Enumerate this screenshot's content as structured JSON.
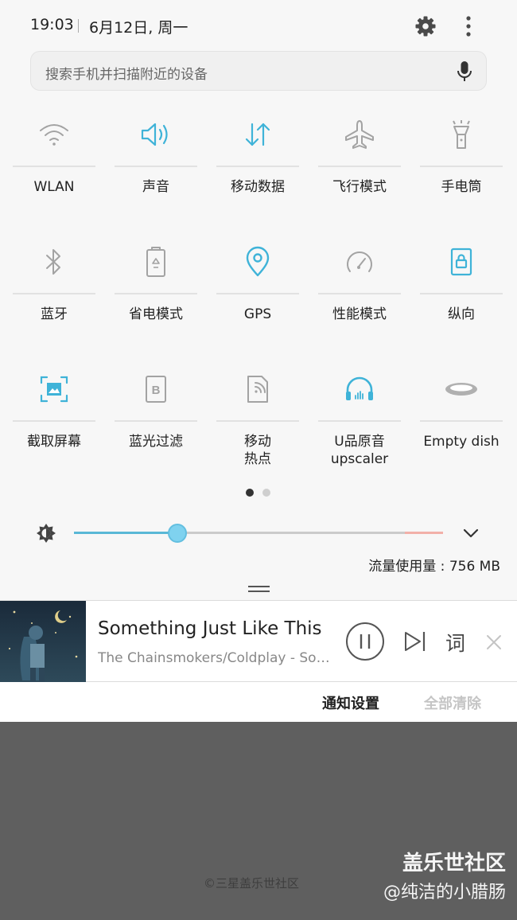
{
  "status_bar": {
    "time": "19:03",
    "date": "6月12日, 周一"
  },
  "search": {
    "placeholder": "搜索手机并扫描附近的设备"
  },
  "tiles": [
    {
      "label": "WLAN",
      "icon": "wifi-icon",
      "active": false
    },
    {
      "label": "声音",
      "icon": "sound-icon",
      "active": true
    },
    {
      "label": "移动数据",
      "icon": "mobile-data-icon",
      "active": true
    },
    {
      "label": "飞行模式",
      "icon": "airplane-icon",
      "active": false
    },
    {
      "label": "手电筒",
      "icon": "flashlight-icon",
      "active": false
    },
    {
      "label": "蓝牙",
      "icon": "bluetooth-icon",
      "active": false
    },
    {
      "label": "省电模式",
      "icon": "battery-saver-icon",
      "active": false
    },
    {
      "label": "GPS",
      "icon": "gps-icon",
      "active": true
    },
    {
      "label": "性能模式",
      "icon": "performance-icon",
      "active": false
    },
    {
      "label": "纵向",
      "icon": "portrait-lock-icon",
      "active": true
    },
    {
      "label": "截取屏幕",
      "icon": "screenshot-icon",
      "active": true
    },
    {
      "label": "蓝光过滤",
      "icon": "blue-light-filter-icon",
      "active": false
    },
    {
      "label": "移动\n热点",
      "icon": "hotspot-icon",
      "active": false
    },
    {
      "label": "U品原音\nupscaler",
      "icon": "headphones-icon",
      "active": true
    },
    {
      "label": "Empty dish",
      "icon": "dish-icon",
      "active": false
    }
  ],
  "pager": {
    "pages": 2,
    "current": 1
  },
  "brightness": {
    "level": 0.28
  },
  "data_usage": "流量使用量 : 756 MB",
  "media": {
    "title": "Something Just Like This",
    "artist": "The Chainsmokers/Coldplay - Something Just Like This",
    "lyrics_label": "词"
  },
  "bottom": {
    "notification_settings": "通知设置",
    "clear_all": "全部清除"
  },
  "footer": {
    "copyright": "©三星盖乐世社区",
    "watermark_brand": "盖乐世社区",
    "watermark_user": "@纯洁的小腊肠"
  },
  "colors": {
    "accent": "#3fb3d8",
    "inactive": "#9e9e9e",
    "panel": "#f7f7f7",
    "background": "#5f5f5f"
  }
}
